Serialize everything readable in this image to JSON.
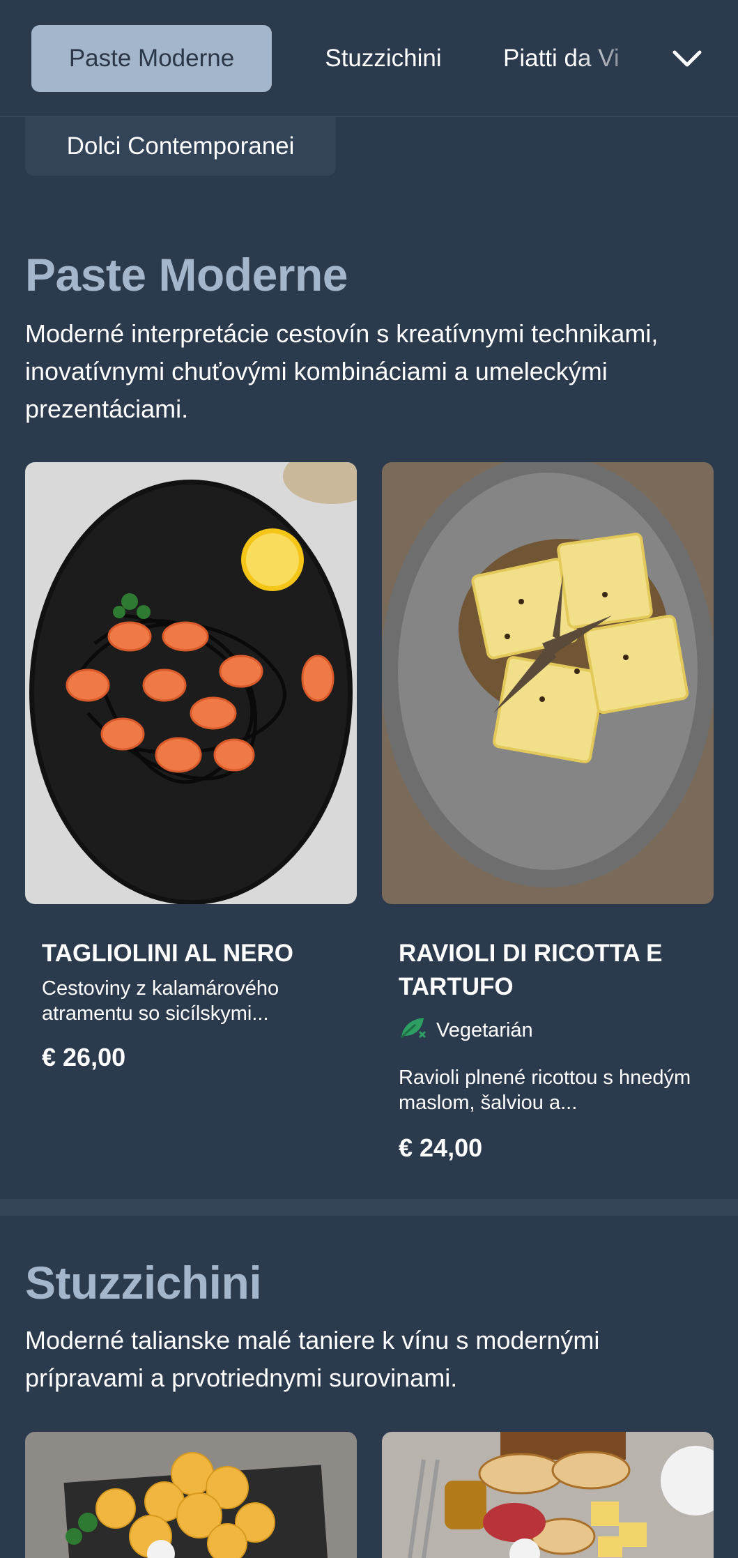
{
  "nav": {
    "tabs": [
      {
        "label": "Paste Moderne",
        "active": true
      },
      {
        "label": "Stuzzichini",
        "active": false
      },
      {
        "label": "Piatti da Vi",
        "active": false
      },
      {
        "label": "Dolci Contemporanei",
        "active": false
      }
    ],
    "more_icon": "chevron-down-icon"
  },
  "sections": [
    {
      "title": "Paste Moderne",
      "description": "Moderné interpretácie cestovín s kreatívnymi technikami, inovatívnymi chuťovými kombináciami a umeleckými prezentáciami.",
      "dishes": [
        {
          "name": "TAGLIOLINI AL NERO",
          "description": "Cestoviny z kalamárového atramentu so sicílskymi...",
          "price": "€ 26,00"
        },
        {
          "name": "RAVIOLI DI RICOTTA E TARTUFO",
          "tag": "Vegetarián",
          "tag_icon": "leaf-icon",
          "description": "Ravioli plnené ricottou s hnedým maslom, šalviou a...",
          "price": "€ 24,00"
        }
      ]
    },
    {
      "title": "Stuzzichini",
      "description": "Moderné talianske malé taniere k vínu s modernými prípravami a prvotriednymi surovinami."
    }
  ],
  "colors": {
    "background": "#2c3a4d",
    "accent": "#a3b6cb",
    "vegetarian": "#2e9e63"
  }
}
